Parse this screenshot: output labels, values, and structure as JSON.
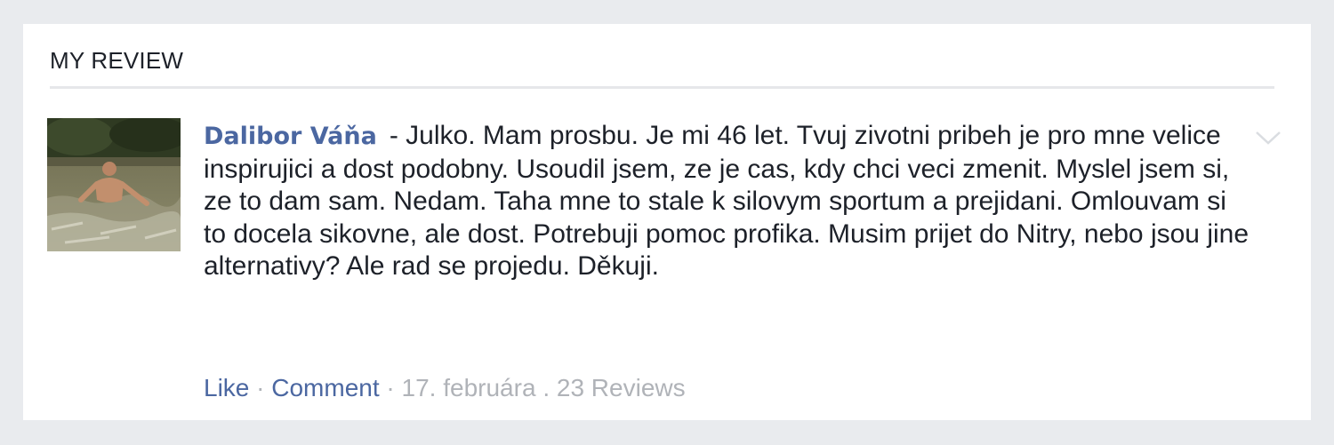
{
  "section": {
    "title": "MY REVIEW"
  },
  "review": {
    "author": "Dalibor Váňa",
    "text": "- Julko. Mam prosbu. Je mi 46 let. Tvuj zivotni pribeh je pro mne velice inspirujici a dost podobny. Usoudil jsem, ze je cas, kdy chci veci zmenit. Myslel jsem si, ze to dam sam. Nedam. Taha mne to stale k silovym sportum a prejidani. Omlouvam si to docela sikovne, ale dost. Potrebuji pomoc profika. Musim prijet do Nitry, nebo jsou jine alternativy? Ale rad se projedu. Děkuji.",
    "actions": {
      "like": "Like",
      "comment": "Comment",
      "separator": "·",
      "date": "17. februára",
      "reviews_separator": ".",
      "reviews": "23 Reviews"
    },
    "menu_icon": "chevron-down-icon"
  },
  "colors": {
    "background": "#e9ebee",
    "card": "#ffffff",
    "link": "#4b67a1",
    "muted": "#b0b3b8"
  }
}
